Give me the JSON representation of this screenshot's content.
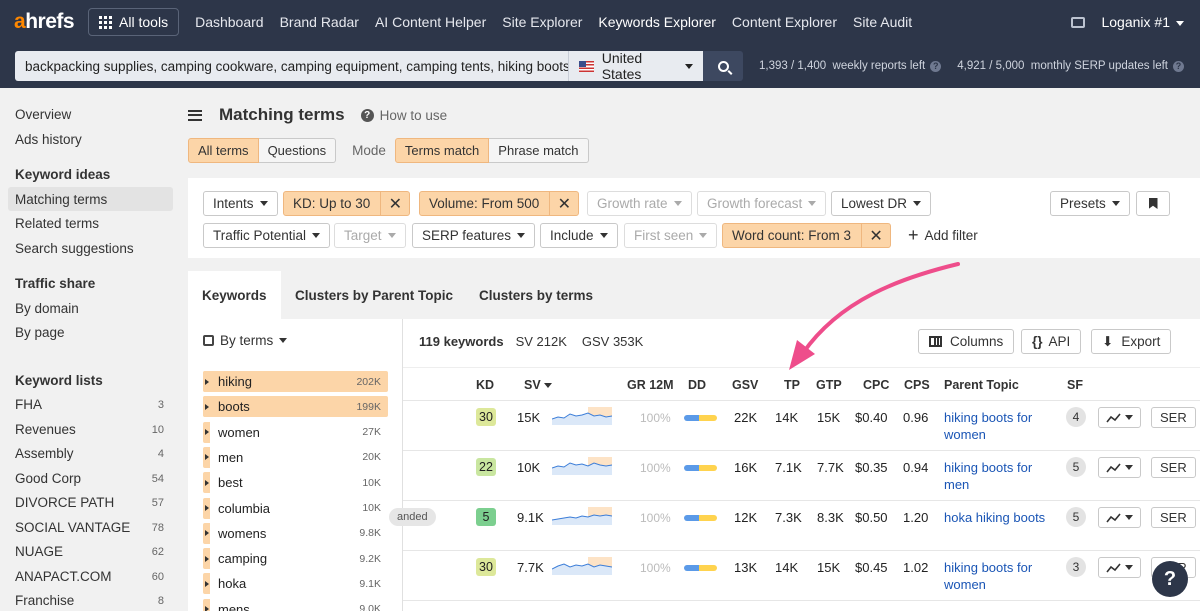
{
  "topbar": {
    "logo_a": "a",
    "logo_rest": "hrefs",
    "all_tools": "All tools",
    "nav": [
      "Dashboard",
      "Brand Radar",
      "AI Content Helper",
      "Site Explorer",
      "Keywords Explorer",
      "Content Explorer",
      "Site Audit"
    ],
    "active_nav": "Keywords Explorer",
    "account": "Loganix #1"
  },
  "search": {
    "query": "backpacking supplies, camping cookware, camping equipment, camping tents, hiking boots, h",
    "country": "United States",
    "weekly_used": "1,393",
    "weekly_total": "1,400",
    "weekly_label": "weekly reports left",
    "monthly_used": "4,921",
    "monthly_total": "5,000",
    "monthly_label": "monthly SERP updates left"
  },
  "sidebar": {
    "items_top": [
      "Overview",
      "Ads history"
    ],
    "keyword_ideas_heading": "Keyword ideas",
    "keyword_ideas": [
      "Matching terms",
      "Related terms",
      "Search suggestions"
    ],
    "traffic_share_heading": "Traffic share",
    "traffic_share": [
      "By domain",
      "By page"
    ],
    "keyword_lists_heading": "Keyword lists",
    "keyword_lists": [
      {
        "name": "FHA",
        "count": "3"
      },
      {
        "name": "Revenues",
        "count": "10"
      },
      {
        "name": "Assembly",
        "count": "4"
      },
      {
        "name": "Good Corp",
        "count": "54"
      },
      {
        "name": "DIVORCE PATH",
        "count": "57"
      },
      {
        "name": "SOCIAL VANTAGE",
        "count": "78"
      },
      {
        "name": "NUAGE",
        "count": "62"
      },
      {
        "name": "ANAPACT.COM",
        "count": "60"
      },
      {
        "name": "Franchise",
        "count": "8"
      }
    ]
  },
  "header": {
    "title": "Matching terms",
    "how_to": "How to use",
    "tabs": [
      "All terms",
      "Questions"
    ],
    "mode_label": "Mode",
    "modes": [
      "Terms match",
      "Phrase match"
    ]
  },
  "filters": {
    "intents": "Intents",
    "kd": "KD: Up to 30",
    "volume": "Volume: From 500",
    "growth_rate": "Growth rate",
    "growth_forecast": "Growth forecast",
    "lowest_dr": "Lowest DR",
    "presets": "Presets",
    "traffic_potential": "Traffic Potential",
    "target": "Target",
    "serp_features": "SERP features",
    "include": "Include",
    "first_seen": "First seen",
    "word_count": "Word count: From 3",
    "add_filter": "Add filter"
  },
  "panel": {
    "tabs": [
      "Keywords",
      "Clusters by Parent Topic",
      "Clusters by terms"
    ],
    "by_terms": "By terms",
    "terms": [
      {
        "t": "hiking",
        "v": "202K"
      },
      {
        "t": "boots",
        "v": "199K"
      },
      {
        "t": "women",
        "v": "27K"
      },
      {
        "t": "men",
        "v": "20K"
      },
      {
        "t": "best",
        "v": "10K"
      },
      {
        "t": "columbia",
        "v": "10K"
      },
      {
        "t": "womens",
        "v": "9.8K"
      },
      {
        "t": "camping",
        "v": "9.2K"
      },
      {
        "t": "hoka",
        "v": "9.1K"
      },
      {
        "t": "mens",
        "v": "9.0K"
      }
    ],
    "keywords_count": "119 keywords",
    "sv": "SV 212K",
    "gsv": "GSV 353K",
    "columns_btn": "Columns",
    "api_btn": "API",
    "export_btn": "Export"
  },
  "table": {
    "headers": {
      "kd": "KD",
      "sv": "SV",
      "gr": "GR 12M",
      "dd": "DD",
      "gsv": "GSV",
      "tp": "TP",
      "gtp": "GTP",
      "cpc": "CPC",
      "cps": "CPS",
      "parent": "Parent Topic",
      "sf": "SF"
    },
    "rows": [
      {
        "kd": "30",
        "sv": "15K",
        "gr": "100%",
        "gsv": "22K",
        "tp": "14K",
        "gtp": "15K",
        "cpc": "$0.40",
        "cps": "0.96",
        "parent": "hiking boots for women",
        "sf": "4",
        "serp": "SER",
        "tag": ""
      },
      {
        "kd": "22",
        "sv": "10K",
        "gr": "100%",
        "gsv": "16K",
        "tp": "7.1K",
        "gtp": "7.7K",
        "cpc": "$0.35",
        "cps": "0.94",
        "parent": "hiking boots for men",
        "sf": "5",
        "serp": "SER",
        "tag": ""
      },
      {
        "kd": "5",
        "sv": "9.1K",
        "gr": "100%",
        "gsv": "12K",
        "tp": "7.3K",
        "gtp": "8.3K",
        "cpc": "$0.50",
        "cps": "1.20",
        "parent": "hoka hiking boots",
        "sf": "5",
        "serp": "SER",
        "tag": "anded"
      },
      {
        "kd": "30",
        "sv": "7.7K",
        "gr": "100%",
        "gsv": "13K",
        "tp": "14K",
        "gtp": "15K",
        "cpc": "$0.45",
        "cps": "1.02",
        "parent": "hiking boots for women",
        "sf": "3",
        "serp": "SER",
        "tag": ""
      }
    ],
    "kd_colors": {
      "30": "#dde89a",
      "22": "#c9e6a0",
      "5": "#7ccf8f"
    }
  },
  "help_label": "?"
}
